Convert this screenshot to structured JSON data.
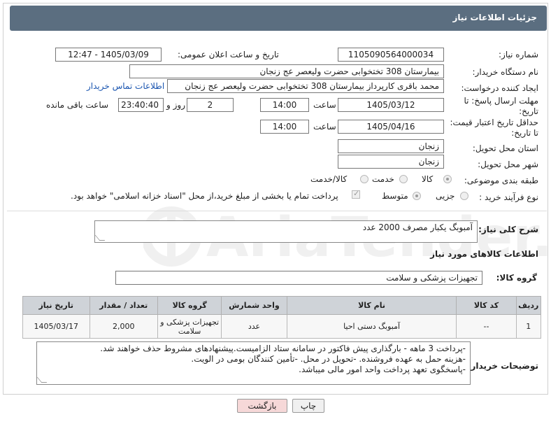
{
  "header": {
    "title": "جزئیات اطلاعات نیاز"
  },
  "fields": {
    "need_number_label": "شماره نیاز:",
    "need_number": "1105090564000034",
    "announce_label": "تاریخ و ساعت اعلان عمومی:",
    "announce_value": "1405/03/09 - 12:47",
    "buyer_org_label": "نام دستگاه خریدار:",
    "buyer_org": "بیمارستان 308 تختخوابی حضرت ولیعصر عج  زنجان",
    "requester_label": "ایجاد کننده درخواست:",
    "requester": "محمد باقری کارپرداز بیمارستان 308 تختخوابی حضرت ولیعصر عج  زنجان",
    "contact_link": "اطلاعات تماس خریدار",
    "deadline_label_1": "مهلت ارسال پاسخ: تا",
    "deadline_label_2": "تاریخ:",
    "deadline_date": "1405/03/12",
    "time_label": "ساعت",
    "deadline_time": "14:00",
    "days_value": "2",
    "days_label": "روز و",
    "remaining_time": "23:40:40",
    "remaining_label": "ساعت باقی مانده",
    "validity_label_1": "حداقل تاریخ اعتبار قیمت:",
    "validity_label_2": "تا تاریخ:",
    "validity_date": "1405/04/16",
    "validity_time_label": "ساعت",
    "validity_time": "14:00",
    "province_label": "استان محل تحویل:",
    "province": "زنجان",
    "city_label": "شهر محل تحویل:",
    "city": "زنجان",
    "category_label": "طبقه بندی موضوعی:",
    "category_options": [
      "کالا",
      "خدمت",
      "کالا/خدمت"
    ],
    "process_label": "نوع فرآیند خرید :",
    "process_options": [
      "جزیی",
      "متوسط"
    ],
    "payment_note": "پرداخت تمام یا بخشی از مبلغ خرید،از محل \"اسناد خزانه اسلامی\" خواهد بود."
  },
  "description": {
    "label": "شرح کلی نیاز:",
    "value": "آمبوبگ یکبار مصرف 2000 عدد"
  },
  "goods_section": {
    "title": "اطلاعات کالاهای مورد نیاز"
  },
  "goods_group": {
    "label": "گروه کالا:",
    "value": "تجهیزات پزشکی و سلامت"
  },
  "table": {
    "headers": [
      "ردیف",
      "کد کالا",
      "نام کالا",
      "واحد شمارش",
      "گروه کالا",
      "تعداد / مقدار",
      "تاریخ نیاز"
    ],
    "rows": [
      [
        "1",
        "--",
        "آمبوبگ دستی احیا",
        "عدد",
        "تجهیزات پزشکی و سلامت",
        "2,000",
        "1405/03/17"
      ]
    ]
  },
  "buyer_notes": {
    "label": "توضیحات خریدار:",
    "line1": "-پرداخت  3 ماهه - بارگذاری پیش فاکتور در سامانه ستاد الزامیست.پیشنهادهای مشروط حذف خواهند شد.",
    "line2": "-هزینه حمل به عهده فروشنده. -تحویل در محل. -تأمین کنندگان بومی در الویت.",
    "line3": "-پاسخگوی تعهد پرداخت واحد امور مالی میباشد."
  },
  "buttons": {
    "print": "چاپ",
    "back": "بازگشت"
  },
  "watermark": {
    "text": "AriaTender.neT"
  }
}
